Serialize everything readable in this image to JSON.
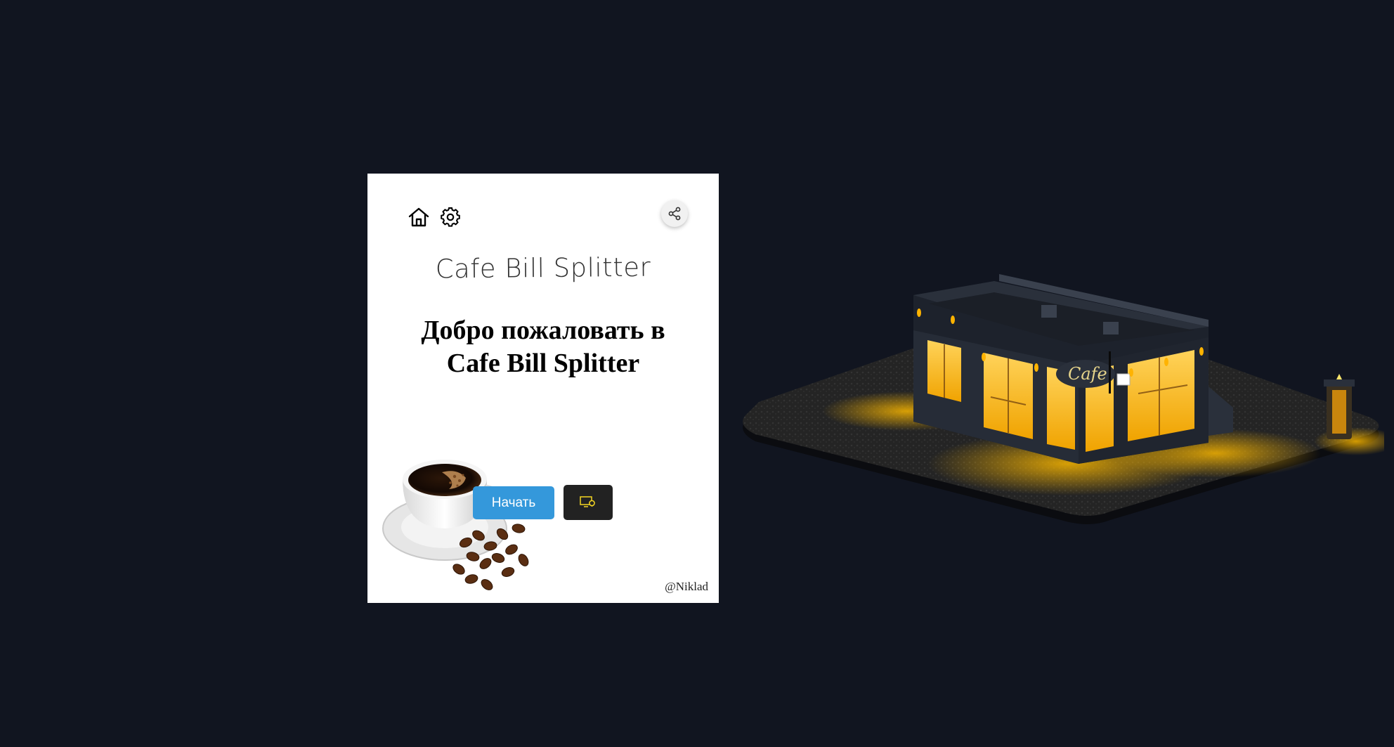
{
  "card": {
    "app_title": "Cafe Bill Splitter",
    "welcome_line1": "Добро пожаловать в",
    "welcome_line2": "Cafe Bill Splitter",
    "start_label": "Начать",
    "credit": "@Niklad"
  },
  "icons": {
    "home": "home-icon",
    "settings": "gear-icon",
    "share": "share-icon",
    "idea": "lightbulb-screen-icon"
  },
  "scene": {
    "sign_text": "Cafe"
  },
  "colors": {
    "background": "#111520",
    "card": "#ffffff",
    "start_button": "#3498db",
    "idea_button": "#222222",
    "window_light": "#f6b400"
  }
}
